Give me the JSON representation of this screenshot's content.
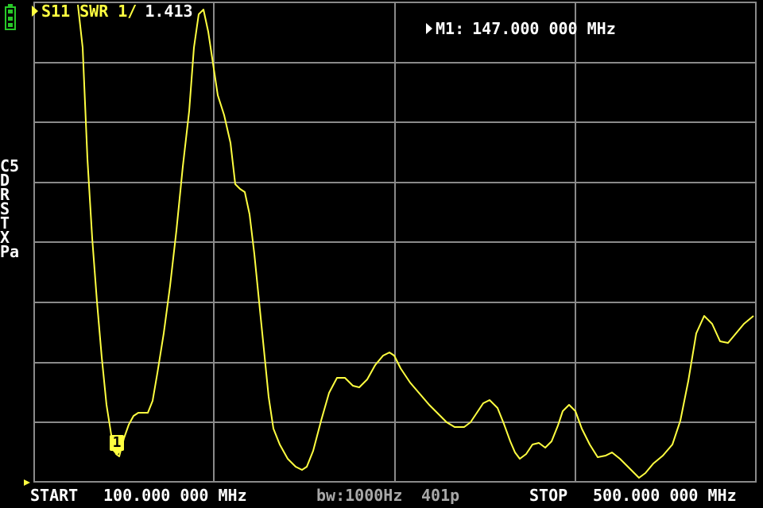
{
  "header": {
    "trace_label": "S11",
    "format": "SWR",
    "scale": "1/",
    "value": "1.413"
  },
  "marker": {
    "label": "M1:",
    "frequency": "147.000 000 MHz",
    "badge": "1"
  },
  "left_menu": [
    "C5",
    "D",
    "R",
    "S",
    "T",
    "X",
    "Pa"
  ],
  "footer": {
    "start_label": "START",
    "start_value": "100.000 000 MHz",
    "bandwidth": "bw:1000Hz",
    "points": "401p",
    "stop_label": "STOP",
    "stop_value": "500.000 000 MHz"
  },
  "colors": {
    "trace": "#ffff40",
    "grid": "#8a8a8a",
    "battery": "#28c828",
    "background": "#000000"
  },
  "icons": {
    "battery": "battery-icon",
    "active_trace": "triangle-pointer-icon",
    "marker_pointer": "triangle-pointer-icon"
  }
}
